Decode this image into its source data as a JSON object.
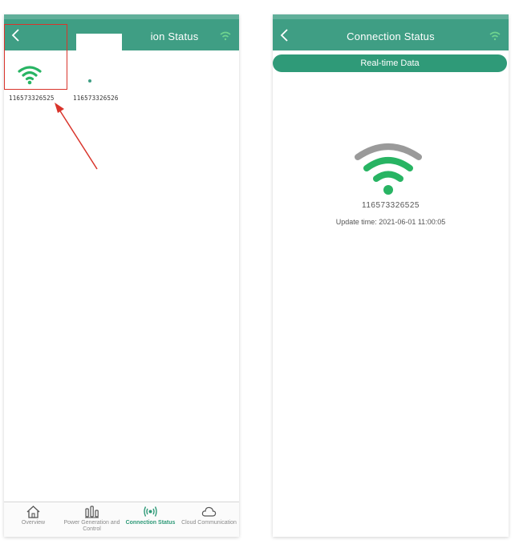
{
  "left_screen": {
    "title_visible": "ion Status",
    "devices": [
      {
        "id": "116573326525",
        "status": "online"
      },
      {
        "id": "116573326526",
        "status": "offline"
      }
    ],
    "bottom_nav": [
      {
        "label": "Overview",
        "icon": "home-icon",
        "active": false
      },
      {
        "label": "Power Generation and Control",
        "icon": "bar-chart-icon",
        "active": false
      },
      {
        "label": "Connection Status",
        "icon": "broadcast-icon",
        "active": true
      },
      {
        "label": "Cloud Communication",
        "icon": "cloud-icon",
        "active": false
      }
    ]
  },
  "right_screen": {
    "title": "Connection Status",
    "realtime_button": "Real-time Data",
    "device_id": "116573326525",
    "update_time": "Update time: 2021-06-01 11:00:05"
  },
  "colors": {
    "header": "#3f9e84",
    "accent": "#2f9a78",
    "wifi_green": "#28b463",
    "wifi_gray": "#9a9a9a",
    "highlight": "#d9342b"
  },
  "icons": {
    "back": "chevron-left-icon",
    "menu": "wifi-signal-icon",
    "wifi": "wifi-icon"
  }
}
